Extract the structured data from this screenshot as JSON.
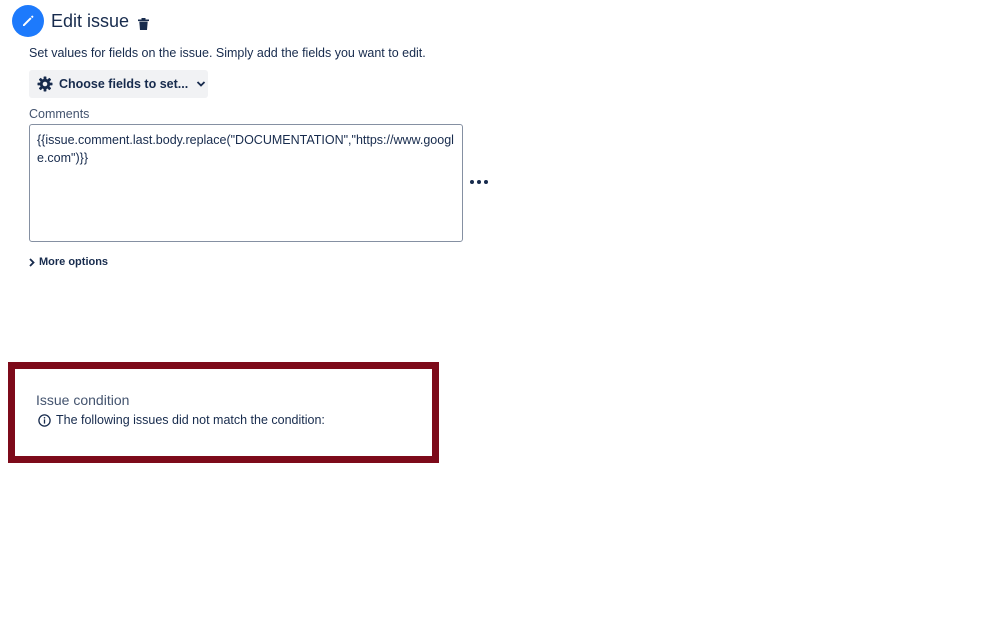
{
  "header": {
    "title": "Edit issue",
    "icon": "pencil-icon",
    "delete_icon": "trash-icon",
    "accent_color": "#1d7afc"
  },
  "description": "Set values for fields on the issue. Simply add the fields you want to edit.",
  "choose_fields": {
    "label": "Choose fields to set...",
    "icon": "gear-icon",
    "dropdown_icon": "chevron-down-icon"
  },
  "comments": {
    "label": "Comments",
    "value": "{{issue.comment.last.body.replace(\"DOCUMENTATION\",\"https://www.google.com\")}}"
  },
  "more_actions_icon": "ellipsis-icon",
  "more_options": {
    "label": "More options",
    "icon": "chevron-right-icon"
  },
  "issue_condition": {
    "title": "Issue condition",
    "icon": "info-icon",
    "message": "The following issues did not match the condition:",
    "highlight_color": "#7d0a1a"
  }
}
